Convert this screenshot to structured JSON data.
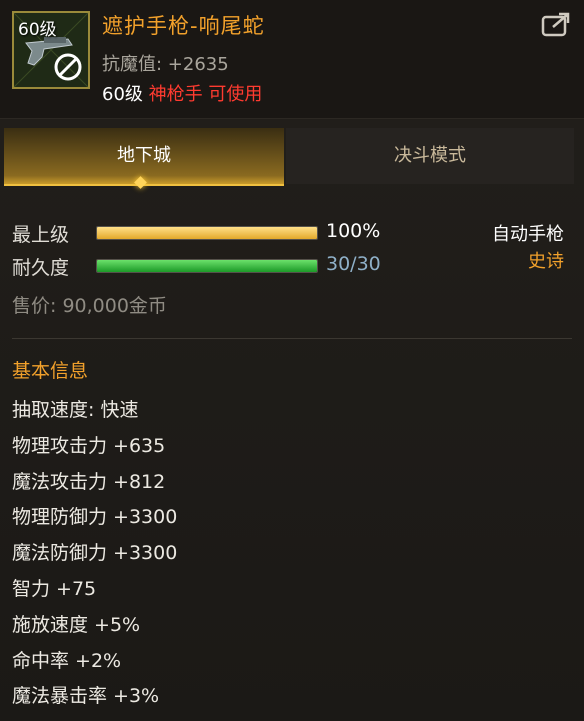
{
  "item": {
    "level_badge": "60级",
    "name": "遮护手枪-响尾蛇",
    "stat_line": "抗魔值: +2635",
    "req_level": "60级",
    "req_class": "神枪手 可使用"
  },
  "tabs": [
    {
      "label": "地下城",
      "active": true
    },
    {
      "label": "决斗模式",
      "active": false
    }
  ],
  "bars": {
    "grade_label": "最上级",
    "grade_value": "100%",
    "grade_fraction": 1.0,
    "durability_label": "耐久度",
    "durability_value": "30/30",
    "durability_fraction": 1.0
  },
  "type": "自动手枪",
  "rarity": "史诗",
  "price": "售价: 90,000金币",
  "section_title": "基本信息",
  "attributes": [
    "抽取速度: 快速",
    "物理攻击力 +635",
    "魔法攻击力 +812",
    "物理防御力 +3300",
    "魔法防御力 +3300",
    "智力 +75",
    "施放速度 +5%",
    "命中率 +2%",
    "魔法暴击率 +3%"
  ],
  "colors": {
    "title": "#f2a12b",
    "class_red": "#ff3b30",
    "grade_bar": "#e3a92a",
    "durability_bar": "#1c9a28",
    "durability_text": "#8fb0c8"
  }
}
